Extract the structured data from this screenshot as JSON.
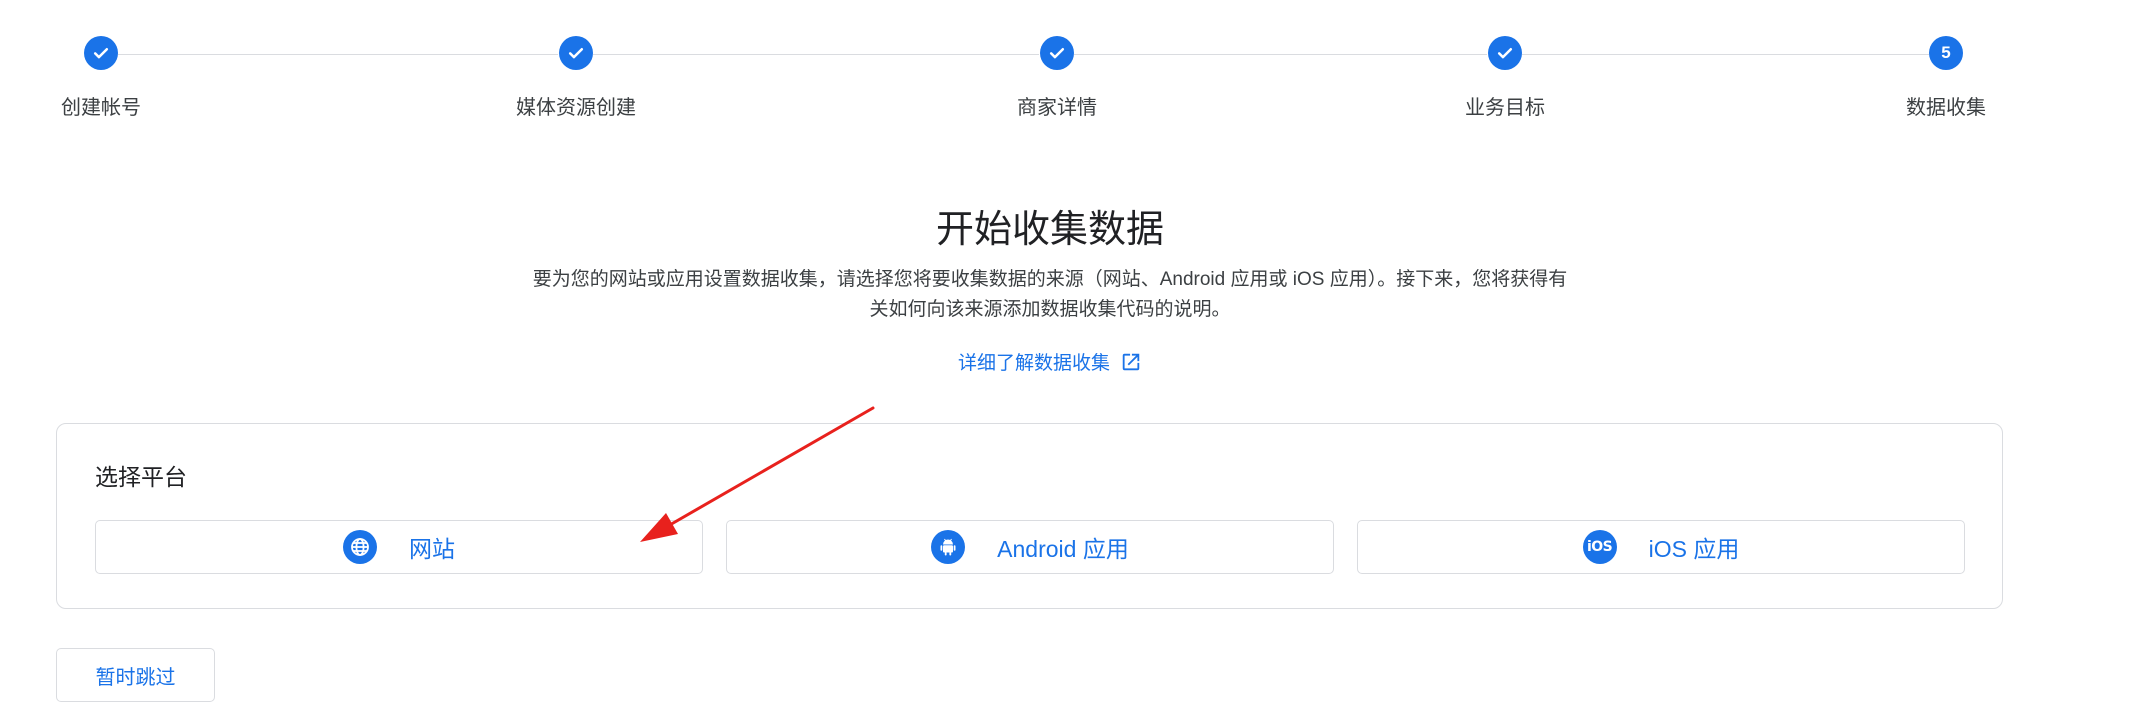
{
  "stepper": {
    "steps": [
      {
        "label": "创建帐号",
        "state": "done"
      },
      {
        "label": "媒体资源创建",
        "state": "done"
      },
      {
        "label": "商家详情",
        "state": "done"
      },
      {
        "label": "业务目标",
        "state": "done"
      },
      {
        "label": "数据收集",
        "state": "current",
        "number": "5"
      }
    ],
    "accent_color": "#1a73e8"
  },
  "main": {
    "title": "开始收集数据",
    "description_line1": "要为您的网站或应用设置数据收集，请选择您将要收集数据的来源（网站、Android 应用或 iOS 应用）。接下来，您将获得有",
    "description_line2": "关如何向该来源添加数据收集代码的说明。",
    "learn_more_label": "详细了解数据收集"
  },
  "platform_card": {
    "title": "选择平台",
    "options": [
      {
        "label": "网站",
        "icon": "globe-icon"
      },
      {
        "label": "Android 应用",
        "icon": "android-icon"
      },
      {
        "label": "iOS 应用",
        "icon": "ios-icon",
        "icon_text": "iOS"
      }
    ]
  },
  "skip_label": "暂时跳过",
  "annotation": {
    "color": "#e8211d",
    "icon": "red-arrow"
  }
}
